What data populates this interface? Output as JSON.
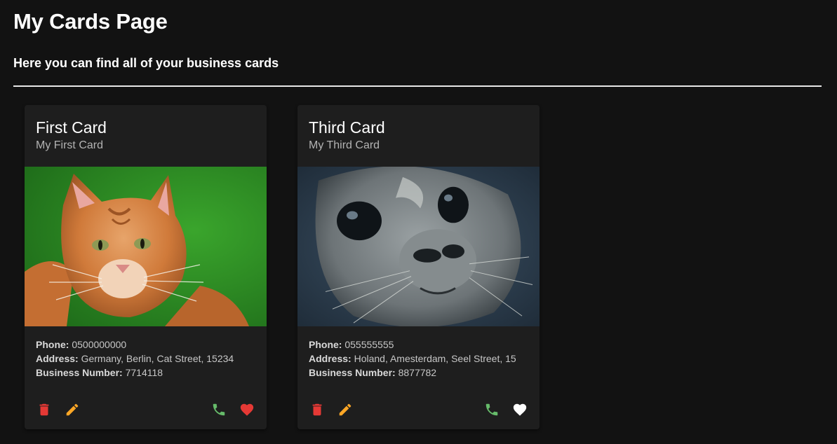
{
  "page": {
    "title": "My Cards Page",
    "subtitle": "Here you can find all of your business cards"
  },
  "cards": [
    {
      "title": "First Card",
      "subtitle": "My First Card",
      "image_subject": "orange tabby cat on green background",
      "phone_label": "Phone:",
      "phone": "0500000000",
      "address_label": "Address:",
      "address": "Germany, Berlin, Cat Street, 15234",
      "bizno_label": "Business Number:",
      "bizno": "7714118",
      "favorite_color": "#e53935"
    },
    {
      "title": "Third Card",
      "subtitle": "My Third Card",
      "image_subject": "seal face close-up underwater",
      "phone_label": "Phone:",
      "phone": "055555555",
      "address_label": "Address:",
      "address": "Holand, Amesterdam, Seel Street, 15",
      "bizno_label": "Business Number:",
      "bizno": "8877782",
      "favorite_color": "#ffffff"
    }
  ],
  "colors": {
    "background": "#121212",
    "card": "#1e1e1e",
    "delete": "#e53935",
    "edit": "#ffa726",
    "call": "#66bb6a"
  },
  "icons": [
    "delete-icon",
    "edit-icon",
    "phone-icon",
    "heart-icon"
  ]
}
